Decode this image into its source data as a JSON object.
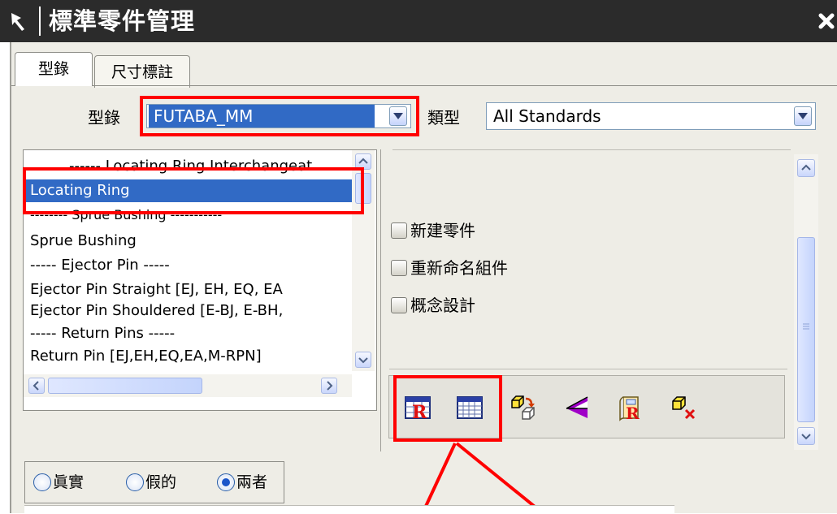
{
  "window": {
    "title": "標準零件管理",
    "icons": {
      "pin": "pin-icon",
      "close": "close-icon"
    }
  },
  "tabs": [
    {
      "label": "型錄",
      "active": true
    },
    {
      "label": "尺寸標註",
      "active": false
    }
  ],
  "catalog": {
    "label": "型錄",
    "value": "FUTABA_MM"
  },
  "type": {
    "label": "類型",
    "value": "All Standards"
  },
  "component_list": {
    "items": [
      {
        "label": "------ Locating Ring Interchangeat",
        "selected": false
      },
      {
        "label": "Locating Ring",
        "selected": true
      },
      {
        "label": "-------- Sprue Bushing -----------",
        "selected": false
      },
      {
        "label": "Sprue Bushing",
        "selected": false
      },
      {
        "label": "----- Ejector Pin -----",
        "selected": false
      },
      {
        "label": "Ejector Pin Straight [EJ, EH, EQ, EA",
        "selected": false
      },
      {
        "label": "Ejector Pin Shouldered [E-BJ, E-BH,",
        "selected": false
      },
      {
        "label": "----- Return Pins -----",
        "selected": false
      },
      {
        "label": "Return Pin [EJ,EH,EQ,EA,M-RPN]",
        "selected": false
      }
    ]
  },
  "options": {
    "new_component": "新建零件",
    "rename_component": "重新命名組件",
    "concept_design": "概念設計"
  },
  "toolbar": {
    "icons": [
      "reuse-library-table-icon",
      "spreadsheet-table-icon",
      "replace-component-icon",
      "reposition-icon",
      "reuse-library-book-icon",
      "remove-component-icon"
    ]
  },
  "filter": {
    "real": "眞實",
    "fake": "假的",
    "both": "兩者",
    "selected": "both"
  },
  "colors": {
    "highlight": "#316ac5",
    "annotation_red": "#ff0000",
    "titlebar": "#2b2b2b"
  }
}
